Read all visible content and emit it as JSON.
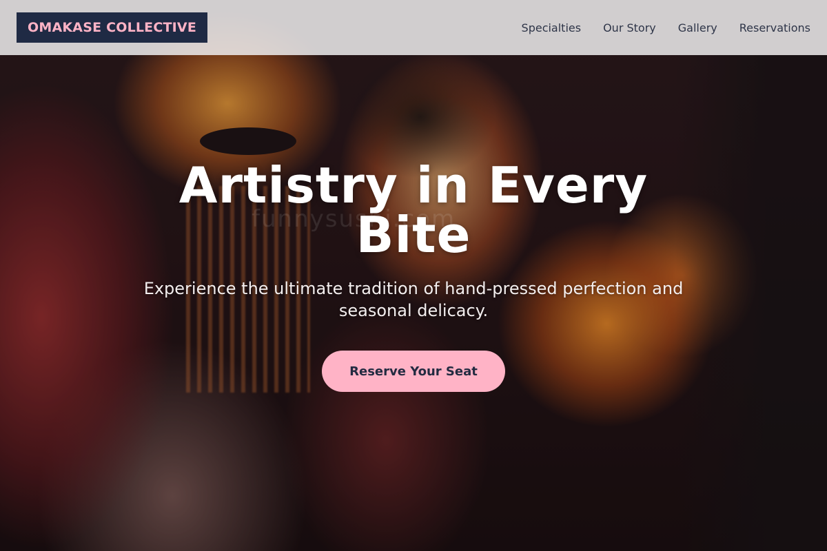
{
  "brand": {
    "logo_text": "OMAKASE COLLECTIVE"
  },
  "nav": {
    "items": [
      {
        "label": "Specialties"
      },
      {
        "label": "Our Story"
      },
      {
        "label": "Gallery"
      },
      {
        "label": "Reservations"
      }
    ]
  },
  "hero": {
    "title": "Artistry in Every Bite",
    "subtitle": "Experience the ultimate tradition of hand-pressed perfection and seasonal delicacy.",
    "cta_label": "Reserve Your Seat",
    "watermark": "funnysushi.com"
  },
  "colors": {
    "accent_pink": "#ffb3c6",
    "navy": "#1f2a44",
    "header_bg": "#eeecee",
    "nav_text": "#2e3548"
  }
}
